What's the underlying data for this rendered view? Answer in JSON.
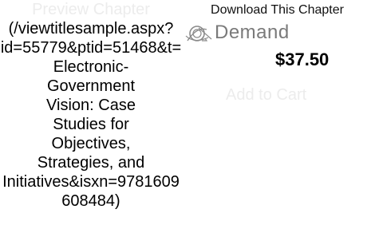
{
  "preview": {
    "label": "Preview Chapter",
    "url_text": "(/viewtitlesample.aspx?\nid=55779&ptid=51468&t=Electronic-\nGovernment\nVision: Case\nStudies for\nObjectives,\nStrategies, and\nInitiatives&isxn=9781609608484)"
  },
  "ondemand": {
    "download_label": "Download This Chapter",
    "logo_icon": "ondemand-logo-icon",
    "logo_text": "Demand",
    "price": "$37.50",
    "add_to_cart_label": "Add to Cart"
  }
}
